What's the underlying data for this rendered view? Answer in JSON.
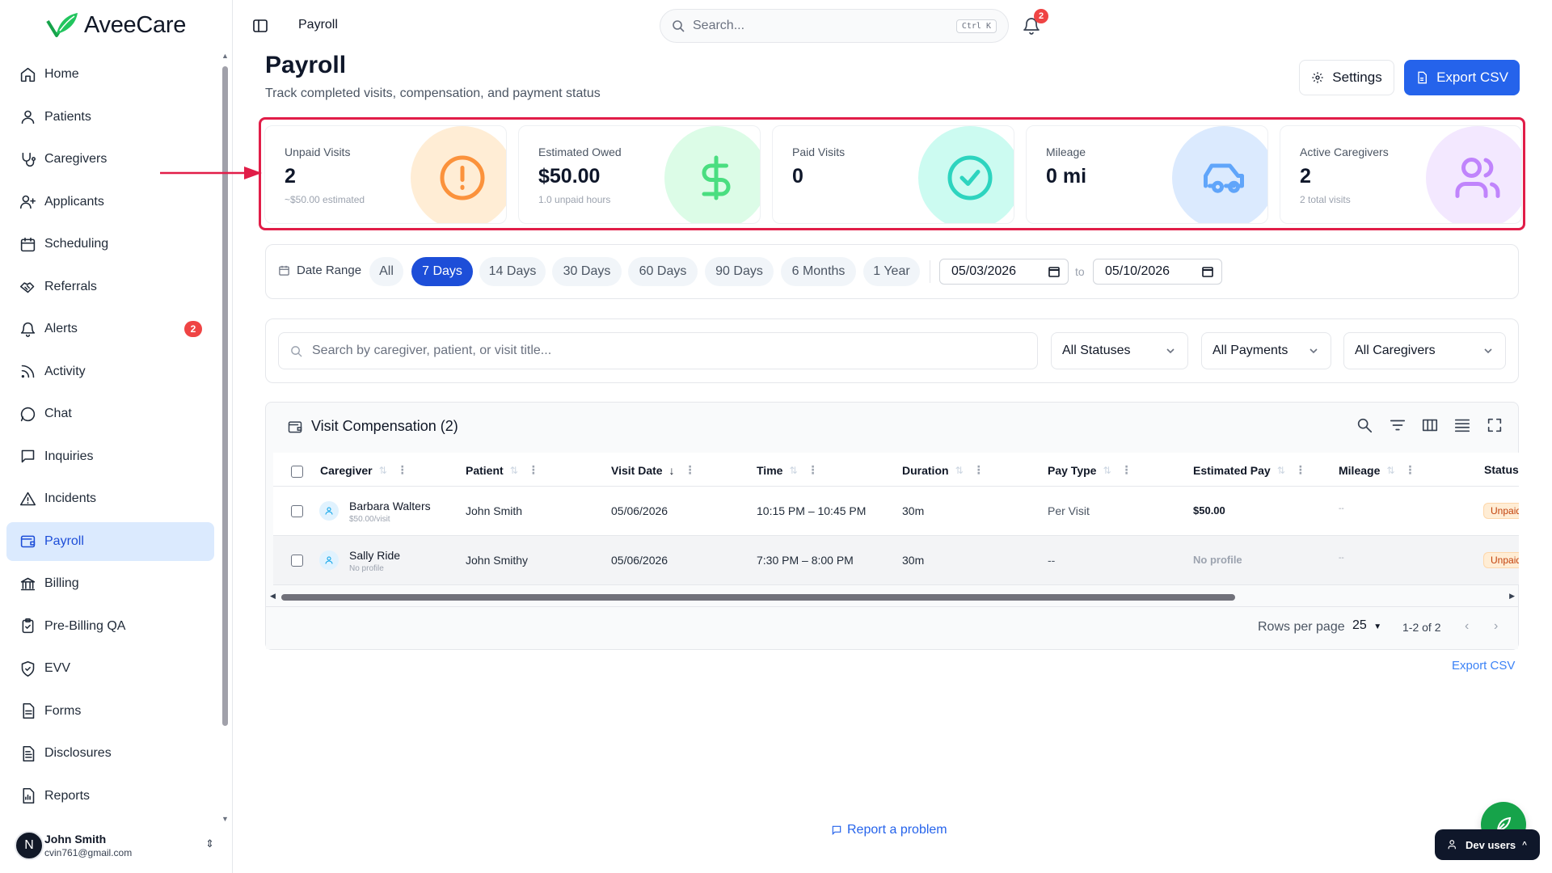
{
  "app": {
    "logo_text": "AveeCare"
  },
  "sidebar": {
    "items": [
      {
        "label": "Home",
        "icon": "home-icon"
      },
      {
        "label": "Patients",
        "icon": "user-icon"
      },
      {
        "label": "Caregivers",
        "icon": "stethoscope-icon"
      },
      {
        "label": "Applicants",
        "icon": "user-plus-icon"
      },
      {
        "label": "Scheduling",
        "icon": "calendar-icon"
      },
      {
        "label": "Referrals",
        "icon": "handshake-icon"
      },
      {
        "label": "Alerts",
        "icon": "bell-icon",
        "badge": "2"
      },
      {
        "label": "Activity",
        "icon": "rss-icon"
      },
      {
        "label": "Chat",
        "icon": "message-circle-icon"
      },
      {
        "label": "Inquiries",
        "icon": "message-square-icon"
      },
      {
        "label": "Incidents",
        "icon": "alert-triangle-icon"
      },
      {
        "label": "Payroll",
        "icon": "wallet-icon",
        "active": true
      },
      {
        "label": "Billing",
        "icon": "landmark-icon"
      },
      {
        "label": "Pre-Billing QA",
        "icon": "clipboard-check-icon"
      },
      {
        "label": "EVV",
        "icon": "shield-check-icon"
      },
      {
        "label": "Forms",
        "icon": "file-text-icon"
      },
      {
        "label": "Disclosures",
        "icon": "file-list-icon"
      },
      {
        "label": "Reports",
        "icon": "file-chart-icon"
      }
    ],
    "user": {
      "initial": "N",
      "name": "John Smith",
      "email": "cvin761@gmail.com"
    }
  },
  "header": {
    "breadcrumb": "Payroll",
    "search_placeholder": "Search...",
    "search_shortcut": "Ctrl K",
    "notification_count": "2"
  },
  "page": {
    "title": "Payroll",
    "subtitle": "Track completed visits, compensation, and payment status",
    "settings_label": "Settings",
    "export_label": "Export CSV"
  },
  "stats": [
    {
      "label": "Unpaid Visits",
      "value": "2",
      "sub": "~$50.00 estimated",
      "icon": "alert-circle-icon",
      "color": "#fb923c",
      "bg": "#ffedd5"
    },
    {
      "label": "Estimated Owed",
      "value": "$50.00",
      "sub": "1.0 unpaid hours",
      "icon": "dollar-icon",
      "color": "#4ade80",
      "bg": "#dcfce7"
    },
    {
      "label": "Paid Visits",
      "value": "0",
      "sub": "",
      "icon": "check-circle-icon",
      "color": "#2dd4bf",
      "bg": "#ccfbf1"
    },
    {
      "label": "Mileage",
      "value": "0 mi",
      "sub": "",
      "icon": "car-icon",
      "color": "#60a5fa",
      "bg": "#dbeafe"
    },
    {
      "label": "Active Caregivers",
      "value": "2",
      "sub": "2 total visits",
      "icon": "users-icon",
      "color": "#c084fc",
      "bg": "#f3e8ff"
    }
  ],
  "date_range": {
    "label": "Date Range",
    "options": [
      "All",
      "7 Days",
      "14 Days",
      "30 Days",
      "60 Days",
      "90 Days",
      "6 Months",
      "1 Year"
    ],
    "selected": "7 Days",
    "from": "05/03/2026",
    "to_label": "to",
    "to": "05/10/2026"
  },
  "filters": {
    "search_placeholder": "Search by caregiver, patient, or visit title...",
    "status": "All Statuses",
    "payments": "All Payments",
    "caregivers": "All Caregivers"
  },
  "table": {
    "title": "Visit Compensation (2)",
    "columns": [
      "Caregiver",
      "Patient",
      "Visit Date",
      "Time",
      "Duration",
      "Pay Type",
      "Estimated Pay",
      "Mileage",
      "Status"
    ],
    "rows": [
      {
        "caregiver": "Barbara Walters",
        "caregiver_sub": "$50.00/visit",
        "patient": "John Smith",
        "visit_date": "05/06/2026",
        "time": "10:15 PM – 10:45 PM",
        "duration": "30m",
        "pay_type": "Per Visit",
        "estimated_pay": "$50.00",
        "mileage": "--",
        "status": "Unpaid"
      },
      {
        "caregiver": "Sally Ride",
        "caregiver_sub": "No profile",
        "patient": "John Smithy",
        "visit_date": "05/06/2026",
        "time": "7:30 PM – 8:00 PM",
        "duration": "30m",
        "pay_type": "--",
        "estimated_pay": "No profile",
        "mileage": "--",
        "status": "Unpaid"
      }
    ],
    "rows_per_page_label": "Rows per page",
    "rows_per_page": "25",
    "page_range": "1-2 of 2",
    "export_link": "Export CSV"
  },
  "footer": {
    "report_link": "Report a problem",
    "dev_users": "Dev users"
  }
}
